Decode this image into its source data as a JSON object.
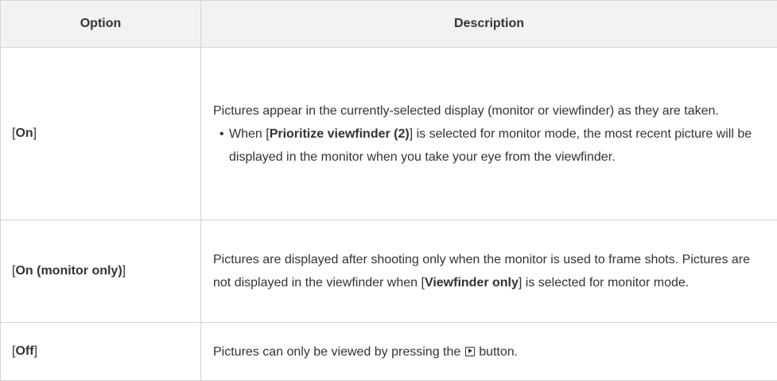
{
  "table": {
    "headers": {
      "option": "Option",
      "description": "Description"
    },
    "rows": [
      {
        "option": {
          "pre": "[",
          "bold": "On",
          "post": "]"
        },
        "description": {
          "intro": "Pictures appear in the currently-selected display (monitor or viewfinder) as they are taken.",
          "bullet_symbol": "•",
          "bullet_pre": "When [",
          "bullet_bold": "Prioritize viewfinder (2)",
          "bullet_post": "] is selected for monitor mode, the most recent picture will be displayed in the monitor when you take your eye from the viewfinder."
        }
      },
      {
        "option": {
          "pre": "[",
          "bold": "On (monitor only)",
          "post": "]"
        },
        "description": {
          "pre": "Pictures are displayed after shooting only when the monitor is used to frame shots. Pictures are not displayed in the viewfinder when [",
          "bold": "Viewfinder only",
          "post": "] is selected for monitor mode."
        }
      },
      {
        "option": {
          "pre": "[",
          "bold": "Off",
          "post": "]"
        },
        "description": {
          "pre": "Pictures can only be viewed by pressing the",
          "icon": "playback-button-icon",
          "post": "button."
        }
      }
    ]
  }
}
